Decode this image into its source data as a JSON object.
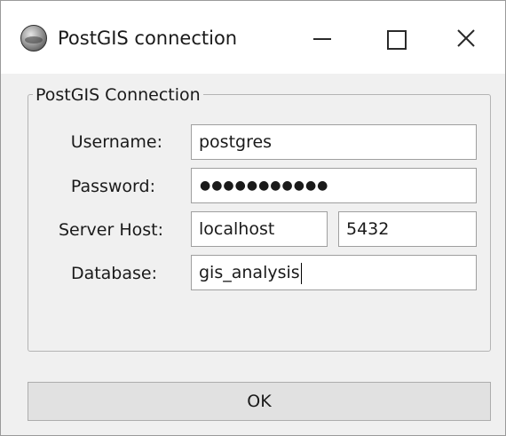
{
  "window": {
    "title": "PostGIS connection",
    "icon": "globe-icon",
    "controls": {
      "minimize": "minimize-icon",
      "maximize": "maximize-icon",
      "close": "close-icon"
    }
  },
  "group": {
    "title": "PostGIS Connection"
  },
  "fields": {
    "username": {
      "label": "Username:",
      "value": "postgres"
    },
    "password": {
      "label": "Password:",
      "value": "●●●●●●●●●●●"
    },
    "server_host": {
      "label": "Server Host:",
      "host_value": "localhost",
      "port_value": "5432"
    },
    "database": {
      "label": "Database:",
      "value": "gis_analysis"
    }
  },
  "buttons": {
    "ok_label": "OK"
  }
}
